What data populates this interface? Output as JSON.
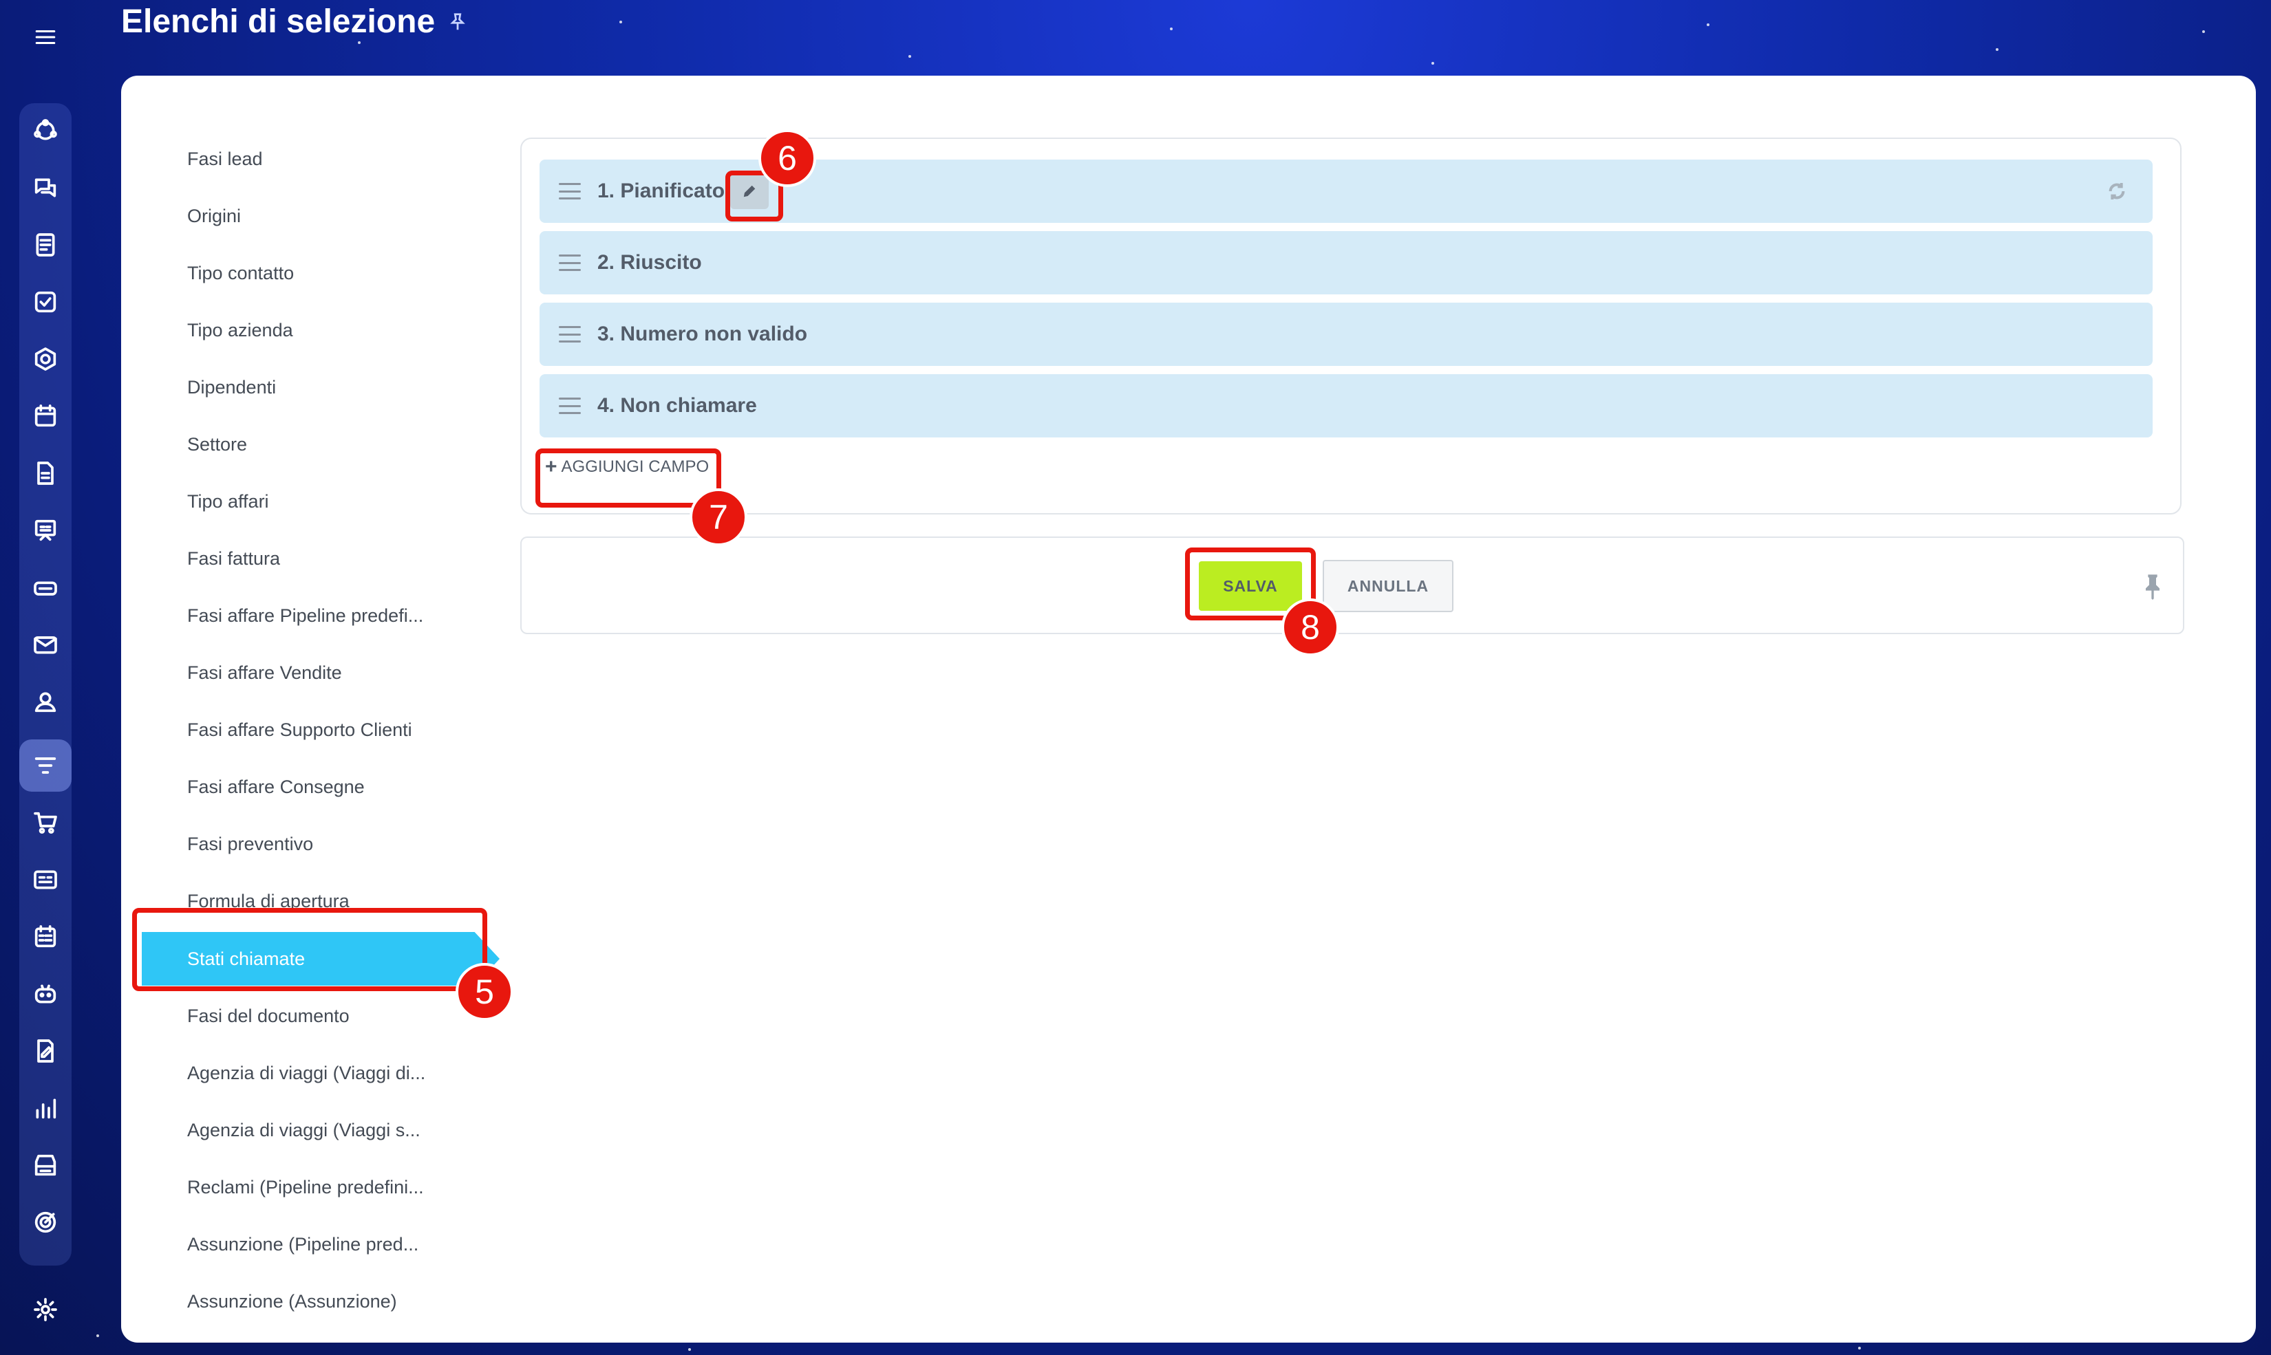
{
  "page": {
    "title": "Elenchi di selezione"
  },
  "sidebar": {
    "items": [
      {
        "label": "Fasi lead"
      },
      {
        "label": "Origini"
      },
      {
        "label": "Tipo contatto"
      },
      {
        "label": "Tipo azienda"
      },
      {
        "label": "Dipendenti"
      },
      {
        "label": "Settore"
      },
      {
        "label": "Tipo affari"
      },
      {
        "label": "Fasi fattura"
      },
      {
        "label": "Fasi affare Pipeline predefi..."
      },
      {
        "label": "Fasi affare Vendite"
      },
      {
        "label": "Fasi affare Supporto Clienti"
      },
      {
        "label": "Fasi affare Consegne"
      },
      {
        "label": "Fasi preventivo"
      },
      {
        "label": "Formula di apertura"
      },
      {
        "label": "Stati chiamate",
        "active": true
      },
      {
        "label": "Fasi del documento"
      },
      {
        "label": "Agenzia di viaggi (Viaggi di..."
      },
      {
        "label": "Agenzia di viaggi (Viaggi s..."
      },
      {
        "label": "Reclami (Pipeline predefini..."
      },
      {
        "label": "Assunzione (Pipeline pred..."
      },
      {
        "label": "Assunzione (Assunzione)"
      }
    ]
  },
  "fields": [
    {
      "label": "1. Pianificato"
    },
    {
      "label": "2. Riuscito"
    },
    {
      "label": "3. Numero non valido"
    },
    {
      "label": "4. Non chiamare"
    }
  ],
  "actions": {
    "add_field": "AGGIUNGI CAMPO",
    "save": "SALVA",
    "cancel": "ANNULLA"
  },
  "annotations": {
    "badge_5": "5",
    "badge_6": "6",
    "badge_7": "7",
    "badge_8": "8"
  },
  "colors": {
    "accent_active": "#2fc6f6",
    "save_button": "#bbed21",
    "field_row": "#d5ebf8",
    "annotation": "#e8170e"
  },
  "icons": {
    "rail": [
      "menu-icon",
      "crm-icon",
      "chat-icon",
      "feed-icon",
      "tasks-icon",
      "sites-icon",
      "calendar-icon",
      "docs-icon",
      "presentation-icon",
      "inventory-icon",
      "mail-icon",
      "contacts-icon",
      "funnel-icon",
      "cart-icon",
      "card-icon",
      "schedule-icon",
      "robot-icon",
      "sign-icon",
      "analytics-icon",
      "store-icon",
      "target-icon",
      "settings-icon"
    ]
  }
}
